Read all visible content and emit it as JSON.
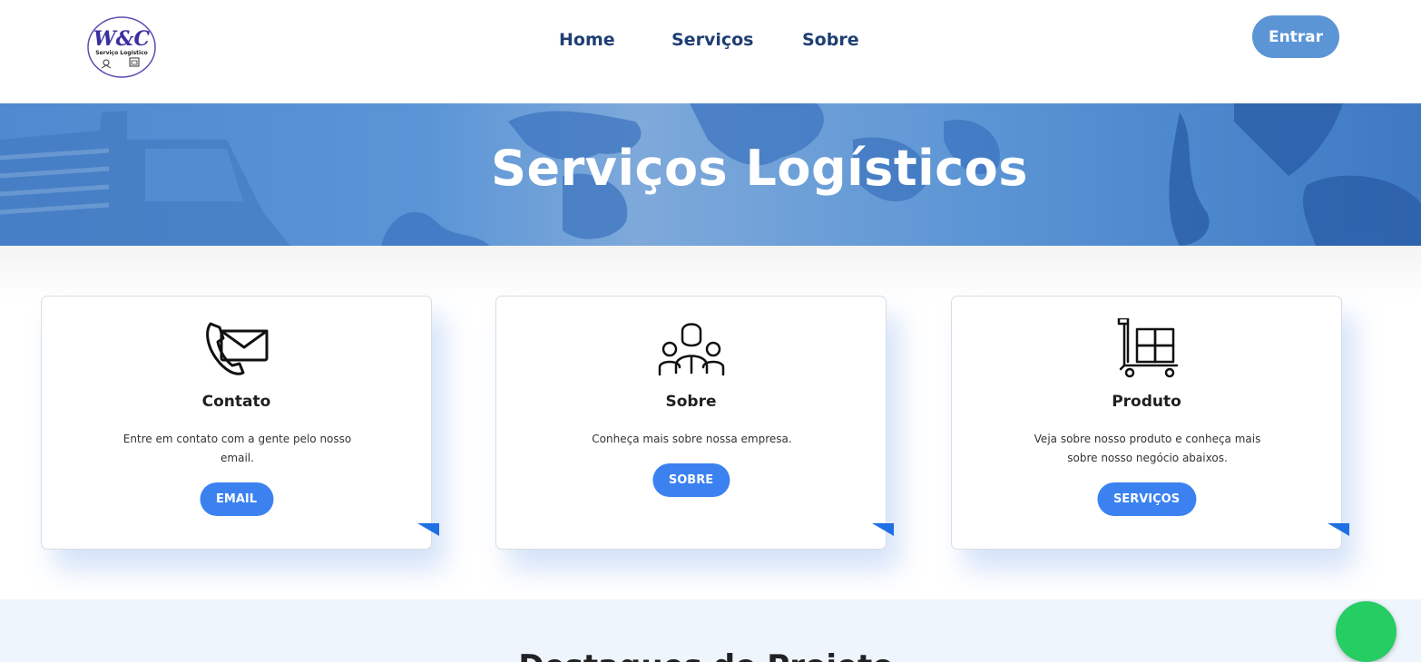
{
  "header": {
    "logo_text": "W&C",
    "logo_subtitle": "Serviço Logístico",
    "nav": [
      {
        "label": "Home"
      },
      {
        "label": "Serviços"
      },
      {
        "label": "Sobre"
      }
    ],
    "login_label": "Entrar"
  },
  "hero": {
    "title": "Serviços Logísticos"
  },
  "cards": [
    {
      "icon": "phone-mail-icon",
      "title": "Contato",
      "description": "Entre em contato com a gente pelo nosso email.",
      "button": "EMAIL"
    },
    {
      "icon": "team-icon",
      "title": "Sobre",
      "description": "Conheça mais sobre nossa empresa.",
      "button": "SOBRE"
    },
    {
      "icon": "cart-boxes-icon",
      "title": "Produto",
      "description": "Veja sobre nosso produto e conheça mais sobre nosso negócio abaixos.",
      "button": "SERVIÇOS"
    }
  ],
  "bottom": {
    "title": "Destaques do Projeto"
  },
  "colors": {
    "accent": "#3b82f0",
    "nav_text": "#1f3f73",
    "login_button": "#5b95d6",
    "whatsapp": "#25cd63"
  }
}
